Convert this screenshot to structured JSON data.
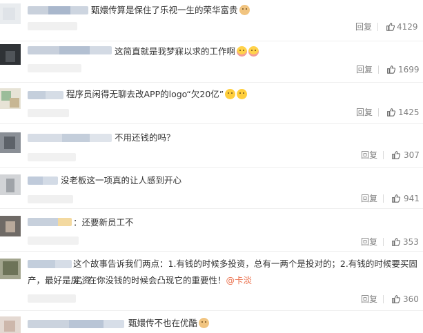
{
  "comments": [
    {
      "text": "甄嬛传算是保住了乐视一生的荣华富贵",
      "emoji_tail": [
        "doge-icon"
      ],
      "reply_label": "回复",
      "like_count": "4129"
    },
    {
      "text": "这简直就是我梦寐以求的工作啊",
      "emoji_tail": [
        "heart-face-icon",
        "heart-face-icon"
      ],
      "reply_label": "回复",
      "like_count": "1699"
    },
    {
      "text": "程序员闲得无聊去改APP的logo“欠20亿”",
      "emoji_tail": [
        "laugh-icon",
        "laugh-icon"
      ],
      "reply_label": "回复",
      "like_count": "1425"
    },
    {
      "text": "不用还钱的吗？",
      "emoji_tail": [],
      "reply_label": "回复",
      "like_count": "307"
    },
    {
      "text": "没老板这一项真的让人感到开心",
      "emoji_tail": [],
      "reply_label": "回复",
      "like_count": "941"
    },
    {
      "text": "：还要新员工不",
      "emoji_tail": [],
      "reply_label": "回复",
      "like_count": "353"
    },
    {
      "text_line1": "这个故事告诉我们两点：1.有钱的时候多投资，总有一两个是投对的；2.有钱的时候要买固定资",
      "text_line2": "产，最好是房，在你没钱的时候会凸现它的重要性！",
      "mention": "@卡淡",
      "reply_label": "回复",
      "like_count": "360"
    },
    {
      "text": "甄嬛传不也在优酷",
      "emoji_tail": [
        "doge-icon"
      ]
    }
  ],
  "colors": {
    "meta_text": "#808080",
    "mention": "#eb7350",
    "divider": "#efefef",
    "body_text": "#333333"
  }
}
